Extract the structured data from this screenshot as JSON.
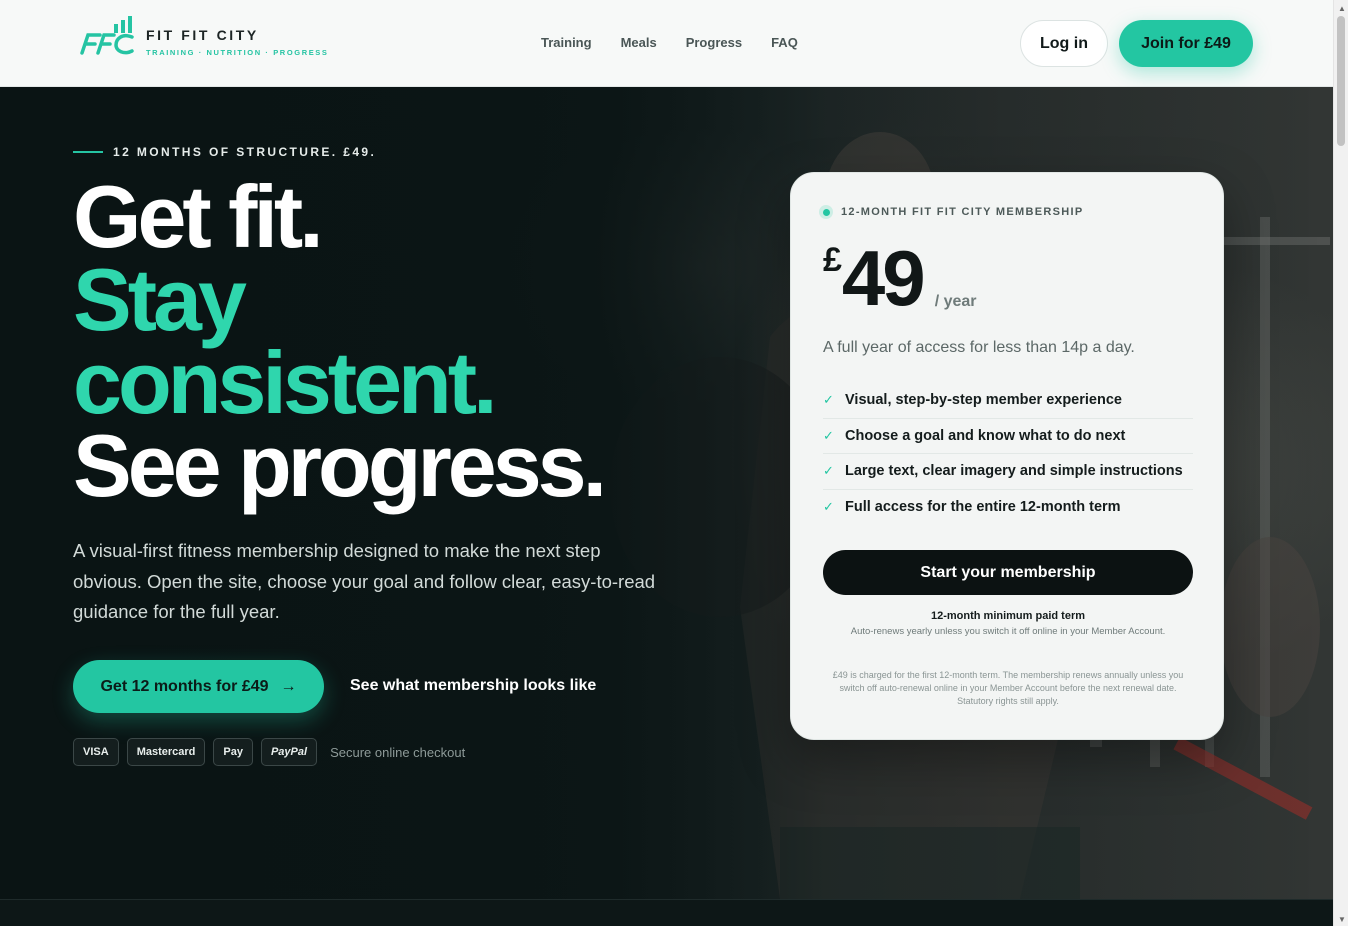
{
  "brand": {
    "name": "FIT FIT CITY",
    "tagline": "TRAINING · NUTRITION · PROGRESS",
    "accent": "#23c6a2"
  },
  "nav": {
    "items": [
      {
        "label": "Training"
      },
      {
        "label": "Meals"
      },
      {
        "label": "Progress"
      },
      {
        "label": "FAQ"
      }
    ],
    "login_label": "Log in",
    "join_label": "Join for £49"
  },
  "hero": {
    "eyebrow": "12 MONTHS OF STRUCTURE. £49.",
    "headline": {
      "line1": "Get fit.",
      "line2": "Stay",
      "line3": "consistent.",
      "line4": "See progress."
    },
    "description": "A visual-first fitness membership designed to make the next step obvious. Open the site, choose your goal and follow clear, easy-to-read guidance for the full year.",
    "cta_primary": "Get 12 months for £49",
    "cta_arrow": "→",
    "cta_secondary": "See what membership looks like",
    "payments": [
      "VISA",
      "Mastercard",
      " Pay",
      "PayPal"
    ],
    "payment_note": "Secure online checkout"
  },
  "card": {
    "label": "12-MONTH FIT FIT CITY MEMBERSHIP",
    "currency": "£",
    "price": "49",
    "period": "/ year",
    "subtitle": "A full year of access for less than 14p a day.",
    "features": [
      "Visual, step-by-step member experience",
      "Choose a goal and know what to do next",
      "Large text, clear imagery and simple instructions",
      "Full access for the entire 12-month term"
    ],
    "check_glyph": "✓",
    "button_label": "Start your membership",
    "term_title": "12-month minimum paid term",
    "term_sub": "Auto-renews yearly unless you switch it off online in your Member Account.",
    "fine_print": "£49 is charged for the first 12-month term. The membership renews annually unless you switch off auto-renewal online in your Member Account before the next renewal date. Statutory rights still apply."
  }
}
